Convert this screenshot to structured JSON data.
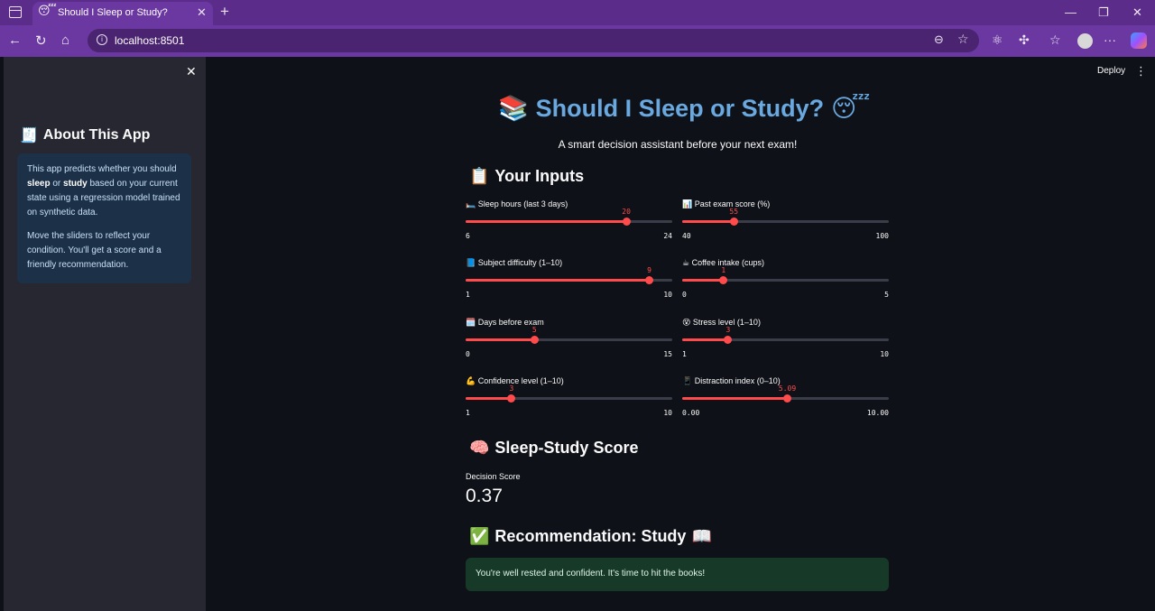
{
  "browser": {
    "tab_title": "Should I Sleep or Study?",
    "tab_icon": "😴",
    "url": "localhost:8501"
  },
  "app": {
    "deploy_label": "Deploy",
    "sidebar": {
      "title": "About This App",
      "title_icon": "🧾",
      "para1_a": "This app predicts whether you should ",
      "para1_b1": "sleep",
      "para1_mid": " or ",
      "para1_b2": "study",
      "para1_c": " based on your current state using a regression model trained on synthetic data.",
      "para2": "Move the sliders to reflect your condition. You'll get a score and a friendly recommendation."
    },
    "title": "Should I Sleep or Study?",
    "title_icon_left": "📚",
    "title_icon_right": "😴",
    "subtitle": "A smart decision assistant before your next exam!",
    "inputs_header": "Your Inputs",
    "inputs_icon": "📋",
    "sliders": [
      {
        "icon": "🛏️",
        "label": "Sleep hours (last 3 days)",
        "value": "20",
        "num": 20,
        "min": "6",
        "max": "24",
        "minv": 6,
        "maxv": 24
      },
      {
        "icon": "📊",
        "label": "Past exam score (%)",
        "value": "55",
        "num": 55,
        "min": "40",
        "max": "100",
        "minv": 40,
        "maxv": 100
      },
      {
        "icon": "📘",
        "label": "Subject difficulty (1–10)",
        "value": "9",
        "num": 9,
        "min": "1",
        "max": "10",
        "minv": 1,
        "maxv": 10
      },
      {
        "icon": "☕",
        "label": "Coffee intake (cups)",
        "value": "1",
        "num": 1,
        "min": "0",
        "max": "5",
        "minv": 0,
        "maxv": 5
      },
      {
        "icon": "🗓️",
        "label": "Days before exam",
        "value": "5",
        "num": 5,
        "min": "0",
        "max": "15",
        "minv": 0,
        "maxv": 15
      },
      {
        "icon": "😵",
        "label": "Stress level (1–10)",
        "value": "3",
        "num": 3,
        "min": "1",
        "max": "10",
        "minv": 1,
        "maxv": 10
      },
      {
        "icon": "💪",
        "label": "Confidence level (1–10)",
        "value": "3",
        "num": 3,
        "min": "1",
        "max": "10",
        "minv": 1,
        "maxv": 10
      },
      {
        "icon": "📱",
        "label": "Distraction index (0–10)",
        "value": "5.09",
        "num": 5.09,
        "min": "0.00",
        "max": "10.00",
        "minv": 0,
        "maxv": 10
      }
    ],
    "score_header": "Sleep-Study Score",
    "score_icon": "🧠",
    "metric_label": "Decision Score",
    "metric_value": "0.37",
    "recommendation_header": "Recommendation: Study",
    "recommendation_icon_left": "✅",
    "recommendation_icon_right": "📖",
    "success_message": "You're well rested and confident. It's time to hit the books!"
  }
}
